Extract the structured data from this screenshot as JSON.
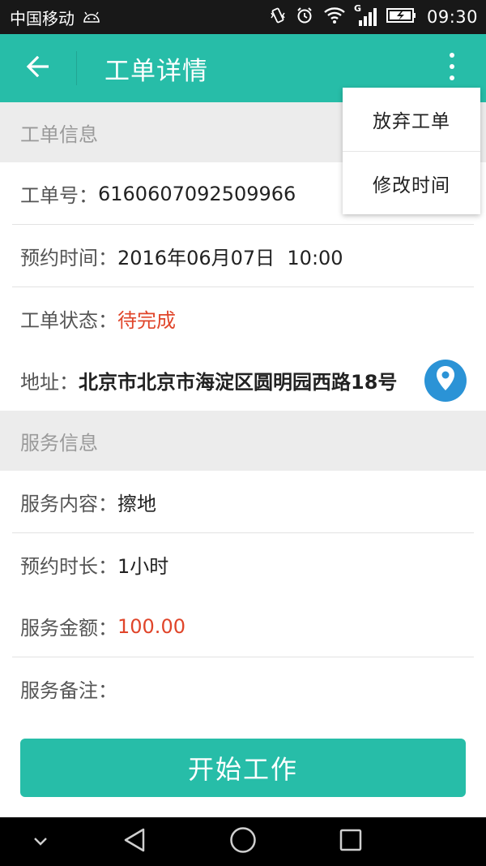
{
  "status_bar": {
    "carrier": "中国移动",
    "network_badge": "G",
    "time": "09:30",
    "icons": [
      "android-icon",
      "vibrate-icon",
      "alarm-icon",
      "wifi-icon",
      "signal-icon",
      "battery-icon"
    ]
  },
  "app_bar": {
    "title": "工单详情",
    "back_icon": "arrow-left-icon",
    "more_icon": "more-vertical-icon"
  },
  "menu": {
    "items": [
      {
        "label": "放弃工单"
      },
      {
        "label": "修改时间"
      }
    ]
  },
  "order_section": {
    "header": "工单信息",
    "order_no": {
      "label": "工单号：",
      "value": "6160607092509966"
    },
    "appointment_time": {
      "label": "预约时间：",
      "value": "2016年06月07日  10:00"
    },
    "status": {
      "label": "工单状态：",
      "value": "待完成"
    },
    "address": {
      "label": "地址：",
      "value": "北京市北京市海淀区圆明园西路18号",
      "icon": "location-pin-icon"
    }
  },
  "service_section": {
    "header": "服务信息",
    "content": {
      "label": "服务内容：",
      "value": "擦地"
    },
    "duration": {
      "label": "预约时长：",
      "value": "1小时"
    },
    "amount": {
      "label": "服务金额：",
      "value": "100.00"
    },
    "note": {
      "label": "服务备注：",
      "value": ""
    }
  },
  "primary_action": {
    "label": "开始工作"
  },
  "colors": {
    "accent": "#27bda8",
    "status_red": "#e0452a",
    "location_blue": "#2b93d6"
  },
  "nav_bar": {
    "icons": [
      "chevron-down-icon",
      "back-triangle-icon",
      "home-circle-icon",
      "recents-square-icon"
    ]
  }
}
